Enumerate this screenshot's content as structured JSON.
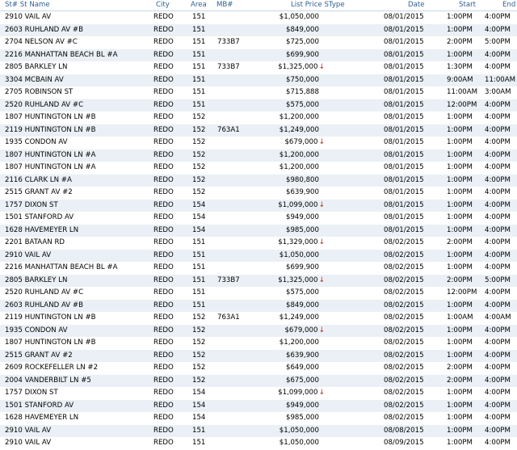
{
  "header": {
    "st_name": "St# St Name",
    "city": "City",
    "area": "Area",
    "mb": "MB#",
    "list_price": "List Price SType",
    "date": "Date",
    "start": "Start",
    "end": "End"
  },
  "rows": [
    {
      "st": "2910 VAIL AV",
      "city": "REDO",
      "area": "151",
      "mb": "",
      "price": "$1,050,000",
      "down": false,
      "date": "08/01/2015",
      "start": "1:00PM",
      "end": "4:00PM"
    },
    {
      "st": "2603 RUHLAND AV #B",
      "city": "REDO",
      "area": "151",
      "mb": "",
      "price": "$849,000",
      "down": false,
      "date": "08/01/2015",
      "start": "1:00PM",
      "end": "4:00PM"
    },
    {
      "st": "2704 NELSON AV #C",
      "city": "REDO",
      "area": "151",
      "mb": "733B7",
      "price": "$725,000",
      "down": false,
      "date": "08/01/2015",
      "start": "2:00PM",
      "end": "5:00PM"
    },
    {
      "st": "2216 MANHATTAN BEACH BL #A",
      "city": "REDO",
      "area": "151",
      "mb": "",
      "price": "$699,900",
      "down": false,
      "date": "08/01/2015",
      "start": "1:00PM",
      "end": "4:00PM"
    },
    {
      "st": "2805 BARKLEY LN",
      "city": "REDO",
      "area": "151",
      "mb": "733B7",
      "price": "$1,325,000",
      "down": true,
      "date": "08/01/2015",
      "start": "1:30PM",
      "end": "4:00PM"
    },
    {
      "st": "3304 MCBAIN AV",
      "city": "REDO",
      "area": "151",
      "mb": "",
      "price": "$750,000",
      "down": false,
      "date": "08/01/2015",
      "start": "9:00AM",
      "end": "11:00AM"
    },
    {
      "st": "2705 ROBINSON ST",
      "city": "REDO",
      "area": "151",
      "mb": "",
      "price": "$715,888",
      "down": false,
      "date": "08/01/2015",
      "start": "11:00AM",
      "end": "3:00AM"
    },
    {
      "st": "2520 RUHLAND AV #C",
      "city": "REDO",
      "area": "151",
      "mb": "",
      "price": "$575,000",
      "down": false,
      "date": "08/01/2015",
      "start": "12:00PM",
      "end": "4:00PM"
    },
    {
      "st": "1807 HUNTINGTON LN #B",
      "city": "REDO",
      "area": "152",
      "mb": "",
      "price": "$1,200,000",
      "down": false,
      "date": "08/01/2015",
      "start": "1:00PM",
      "end": "4:00PM"
    },
    {
      "st": "2119 HUNTINGTON LN #B",
      "city": "REDO",
      "area": "152",
      "mb": "763A1",
      "price": "$1,249,000",
      "down": false,
      "date": "08/01/2015",
      "start": "1:00PM",
      "end": "4:00PM"
    },
    {
      "st": "1935 CONDON AV",
      "city": "REDO",
      "area": "152",
      "mb": "",
      "price": "$679,000",
      "down": true,
      "date": "08/01/2015",
      "start": "1:00PM",
      "end": "4:00PM"
    },
    {
      "st": "1807 HUNTINGTON LN #A",
      "city": "REDO",
      "area": "152",
      "mb": "",
      "price": "$1,200,000",
      "down": false,
      "date": "08/01/2015",
      "start": "1:00PM",
      "end": "4:00PM"
    },
    {
      "st": "1807 HUNTINGTON LN #A",
      "city": "REDO",
      "area": "152",
      "mb": "",
      "price": "$1,200,000",
      "down": false,
      "date": "08/01/2015",
      "start": "1:00PM",
      "end": "4:00PM"
    },
    {
      "st": "2116 CLARK LN #A",
      "city": "REDO",
      "area": "152",
      "mb": "",
      "price": "$980,800",
      "down": false,
      "date": "08/01/2015",
      "start": "1:00PM",
      "end": "4:00PM"
    },
    {
      "st": "2515 GRANT AV #2",
      "city": "REDO",
      "area": "152",
      "mb": "",
      "price": "$639,900",
      "down": false,
      "date": "08/01/2015",
      "start": "1:00PM",
      "end": "4:00PM"
    },
    {
      "st": "1757 DIXON ST",
      "city": "REDO",
      "area": "154",
      "mb": "",
      "price": "$1,099,000",
      "down": true,
      "date": "08/01/2015",
      "start": "1:00PM",
      "end": "4:00PM"
    },
    {
      "st": "1501 STANFORD AV",
      "city": "REDO",
      "area": "154",
      "mb": "",
      "price": "$949,000",
      "down": false,
      "date": "08/01/2015",
      "start": "1:00PM",
      "end": "4:00PM"
    },
    {
      "st": "1628 HAVEMEYER LN",
      "city": "REDO",
      "area": "154",
      "mb": "",
      "price": "$985,000",
      "down": false,
      "date": "08/01/2015",
      "start": "1:00PM",
      "end": "4:00PM"
    },
    {
      "st": "2201 BATAAN RD",
      "city": "REDO",
      "area": "151",
      "mb": "",
      "price": "$1,329,000",
      "down": true,
      "date": "08/02/2015",
      "start": "2:00PM",
      "end": "4:00PM"
    },
    {
      "st": "2910 VAIL AV",
      "city": "REDO",
      "area": "151",
      "mb": "",
      "price": "$1,050,000",
      "down": false,
      "date": "08/02/2015",
      "start": "1:00PM",
      "end": "4:00PM"
    },
    {
      "st": "2216 MANHATTAN BEACH BL #A",
      "city": "REDO",
      "area": "151",
      "mb": "",
      "price": "$699,900",
      "down": false,
      "date": "08/02/2015",
      "start": "1:00PM",
      "end": "4:00PM"
    },
    {
      "st": "2805 BARKLEY LN",
      "city": "REDO",
      "area": "151",
      "mb": "733B7",
      "price": "$1,325,000",
      "down": true,
      "date": "08/02/2015",
      "start": "2:00PM",
      "end": "5:00PM"
    },
    {
      "st": "2520 RUHLAND AV #C",
      "city": "REDO",
      "area": "151",
      "mb": "",
      "price": "$575,000",
      "down": false,
      "date": "08/02/2015",
      "start": "12:00PM",
      "end": "4:00PM"
    },
    {
      "st": "2603 RUHLAND AV #B",
      "city": "REDO",
      "area": "151",
      "mb": "",
      "price": "$849,000",
      "down": false,
      "date": "08/02/2015",
      "start": "1:00PM",
      "end": "4:00PM"
    },
    {
      "st": "2119 HUNTINGTON LN #B",
      "city": "REDO",
      "area": "152",
      "mb": "763A1",
      "price": "$1,249,000",
      "down": false,
      "date": "08/02/2015",
      "start": "1:00AM",
      "end": "4:00AM"
    },
    {
      "st": "1935 CONDON AV",
      "city": "REDO",
      "area": "152",
      "mb": "",
      "price": "$679,000",
      "down": true,
      "date": "08/02/2015",
      "start": "1:00PM",
      "end": "4:00PM"
    },
    {
      "st": "1807 HUNTINGTON LN #B",
      "city": "REDO",
      "area": "152",
      "mb": "",
      "price": "$1,200,000",
      "down": false,
      "date": "08/02/2015",
      "start": "1:00PM",
      "end": "4:00PM"
    },
    {
      "st": "2515 GRANT AV #2",
      "city": "REDO",
      "area": "152",
      "mb": "",
      "price": "$639,900",
      "down": false,
      "date": "08/02/2015",
      "start": "1:00PM",
      "end": "4:00PM"
    },
    {
      "st": "2609 ROCKEFELLER LN #2",
      "city": "REDO",
      "area": "152",
      "mb": "",
      "price": "$649,000",
      "down": false,
      "date": "08/02/2015",
      "start": "2:00PM",
      "end": "4:00PM"
    },
    {
      "st": "2004 VANDERBILT LN #5",
      "city": "REDO",
      "area": "152",
      "mb": "",
      "price": "$675,000",
      "down": false,
      "date": "08/02/2015",
      "start": "2:00PM",
      "end": "4:00PM"
    },
    {
      "st": "1757 DIXON ST",
      "city": "REDO",
      "area": "154",
      "mb": "",
      "price": "$1,099,000",
      "down": true,
      "date": "08/02/2015",
      "start": "1:00PM",
      "end": "4:00PM"
    },
    {
      "st": "1501 STANFORD AV",
      "city": "REDO",
      "area": "154",
      "mb": "",
      "price": "$949,000",
      "down": false,
      "date": "08/02/2015",
      "start": "1:00PM",
      "end": "4:00PM"
    },
    {
      "st": "1628 HAVEMEYER LN",
      "city": "REDO",
      "area": "154",
      "mb": "",
      "price": "$985,000",
      "down": false,
      "date": "08/02/2015",
      "start": "1:00PM",
      "end": "4:00PM"
    },
    {
      "st": "2910 VAIL AV",
      "city": "REDO",
      "area": "151",
      "mb": "",
      "price": "$1,050,000",
      "down": false,
      "date": "08/08/2015",
      "start": "1:00PM",
      "end": "4:00PM"
    },
    {
      "st": "2910 VAIL AV",
      "city": "REDO",
      "area": "151",
      "mb": "",
      "price": "$1,050,000",
      "down": false,
      "date": "08/09/2015",
      "start": "1:00PM",
      "end": "4:00PM"
    }
  ],
  "colors": {
    "header_text": "#2e5f8f",
    "alt_row": "#eaf0f5",
    "down_arrow": "#b02a1f"
  },
  "icons": {
    "price_down": "arrow-down-icon"
  }
}
